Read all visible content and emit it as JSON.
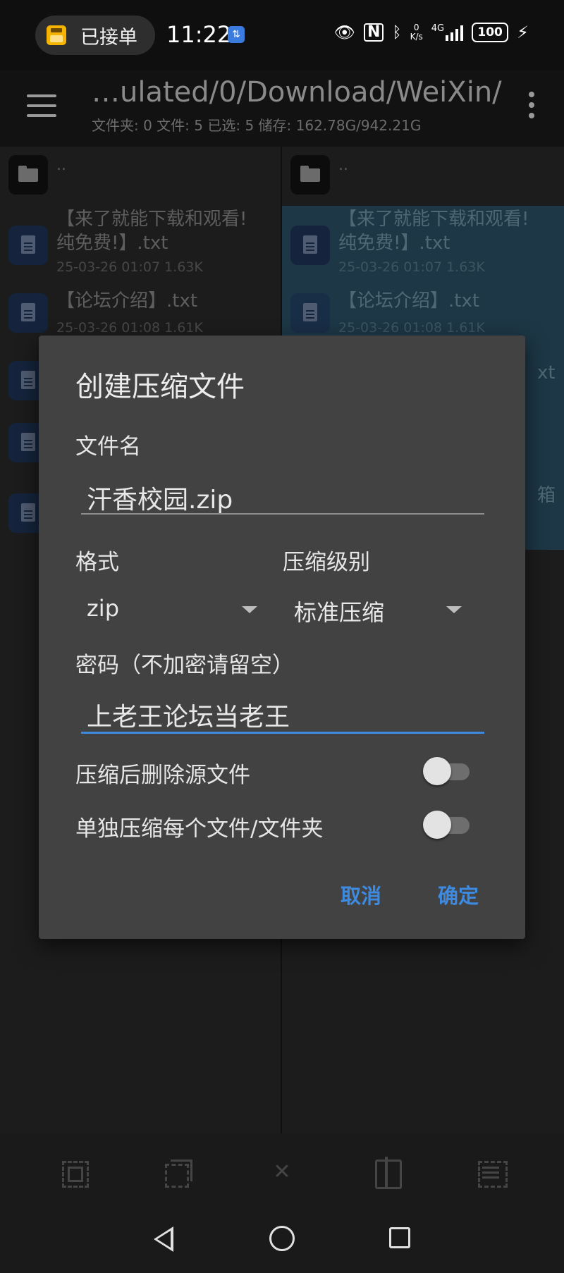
{
  "status": {
    "pill_text": "已接单",
    "time": "11:22",
    "time_badge": "⇅",
    "net_speed_value": "0",
    "net_speed_unit": "K/s",
    "network": "4G",
    "battery": "100"
  },
  "header": {
    "path": "…ulated/0/Download/WeiXin/",
    "summary": "文件夹: 0  文件: 5  已选: 5  储存: 162.78G/942.21G"
  },
  "left_pane": {
    "parent": "..",
    "files": [
      {
        "name_line1": "【来了就能下载和观看!",
        "name_line2": "纯免费!】.txt",
        "meta": "25-03-26 01:07  1.63K"
      },
      {
        "name_line1": "【论坛介绍】.txt",
        "meta": "25-03-26 01:08  1.61K"
      }
    ]
  },
  "right_pane": {
    "parent": "..",
    "files": [
      {
        "name_line1": "【来了就能下载和观看!",
        "name_line2": "纯免费!】.txt",
        "meta": "25-03-26 01:07  1.63K"
      },
      {
        "name_line1": "【论坛介绍】.txt",
        "meta": "25-03-26 01:08  1.61K"
      }
    ],
    "partial_1": "xt",
    "partial_2": "箱"
  },
  "dialog": {
    "title": "创建压缩文件",
    "filename_label": "文件名",
    "filename_value": "汗香校园.zip",
    "format_label": "格式",
    "format_value": "zip",
    "level_label": "压缩级别",
    "level_value": "标准压缩",
    "password_label": "密码（不加密请留空）",
    "password_value": "上老王论坛当老王",
    "delete_source_label": "压缩后删除源文件",
    "delete_source_on": false,
    "separate_label": "单独压缩每个文件/文件夹",
    "separate_on": false,
    "cancel": "取消",
    "ok": "确定"
  },
  "colors": {
    "accent": "#3d8ae0",
    "dialog_bg": "#424242",
    "selected_row": "#1d3746"
  }
}
